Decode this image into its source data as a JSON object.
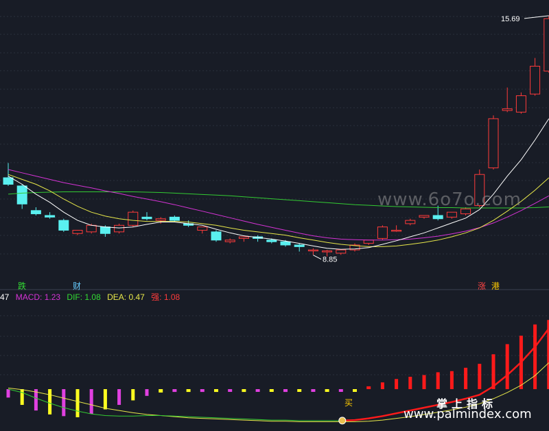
{
  "chart_data": [
    {
      "type": "candlestick",
      "title": "",
      "ylim": [
        7.8,
        16.0
      ],
      "annotations": {
        "high_label": "15.69",
        "low_label": "8.85"
      },
      "signals": [
        {
          "text": "跌",
          "color": "#33dd33"
        },
        {
          "text": "财",
          "color": "#66ccff"
        },
        {
          "text": "涨",
          "color": "#ff4444"
        },
        {
          "text": "港",
          "color": "#ffcc00"
        }
      ],
      "candles": [
        {
          "o": 10.75,
          "h": 11.2,
          "l": 10.5,
          "c": 10.55
        },
        {
          "o": 10.5,
          "h": 10.55,
          "l": 9.8,
          "c": 9.95
        },
        {
          "o": 9.75,
          "h": 9.85,
          "l": 9.6,
          "c": 9.65
        },
        {
          "o": 9.6,
          "h": 9.7,
          "l": 9.5,
          "c": 9.55
        },
        {
          "o": 9.45,
          "h": 9.5,
          "l": 9.1,
          "c": 9.15
        },
        {
          "o": 9.05,
          "h": 9.15,
          "l": 9.0,
          "c": 9.15
        },
        {
          "o": 9.1,
          "h": 9.35,
          "l": 9.05,
          "c": 9.3
        },
        {
          "o": 9.25,
          "h": 9.3,
          "l": 8.95,
          "c": 9.05
        },
        {
          "o": 9.1,
          "h": 9.35,
          "l": 9.05,
          "c": 9.3
        },
        {
          "o": 9.3,
          "h": 9.75,
          "l": 9.25,
          "c": 9.7
        },
        {
          "o": 9.55,
          "h": 9.7,
          "l": 9.45,
          "c": 9.5
        },
        {
          "o": 9.45,
          "h": 9.55,
          "l": 9.35,
          "c": 9.5
        },
        {
          "o": 9.55,
          "h": 9.6,
          "l": 9.4,
          "c": 9.45
        },
        {
          "o": 9.35,
          "h": 9.45,
          "l": 9.25,
          "c": 9.3
        },
        {
          "o": 9.15,
          "h": 9.25,
          "l": 9.05,
          "c": 9.25
        },
        {
          "o": 9.1,
          "h": 9.15,
          "l": 8.8,
          "c": 8.85
        },
        {
          "o": 8.8,
          "h": 8.9,
          "l": 8.75,
          "c": 8.85
        },
        {
          "o": 8.9,
          "h": 8.95,
          "l": 8.8,
          "c": 8.95
        },
        {
          "o": 8.95,
          "h": 9.0,
          "l": 8.8,
          "c": 8.9
        },
        {
          "o": 8.85,
          "h": 8.9,
          "l": 8.75,
          "c": 8.8
        },
        {
          "o": 8.8,
          "h": 8.85,
          "l": 8.65,
          "c": 8.7
        },
        {
          "o": 8.7,
          "h": 8.75,
          "l": 8.5,
          "c": 8.65
        },
        {
          "o": 8.55,
          "h": 8.6,
          "l": 8.4,
          "c": 8.55
        },
        {
          "o": 8.5,
          "h": 8.55,
          "l": 8.35,
          "c": 8.52
        },
        {
          "o": 8.45,
          "h": 8.55,
          "l": 8.4,
          "c": 8.55
        },
        {
          "o": 8.55,
          "h": 8.75,
          "l": 8.5,
          "c": 8.7
        },
        {
          "o": 8.75,
          "h": 8.85,
          "l": 8.7,
          "c": 8.85
        },
        {
          "o": 8.9,
          "h": 9.3,
          "l": 8.85,
          "c": 9.25
        },
        {
          "o": 9.15,
          "h": 9.3,
          "l": 9.1,
          "c": 9.15
        },
        {
          "o": 9.35,
          "h": 9.5,
          "l": 9.3,
          "c": 9.45
        },
        {
          "o": 9.55,
          "h": 9.6,
          "l": 9.5,
          "c": 9.6
        },
        {
          "o": 9.6,
          "h": 9.9,
          "l": 9.45,
          "c": 9.5
        },
        {
          "o": 9.55,
          "h": 9.7,
          "l": 9.5,
          "c": 9.7
        },
        {
          "o": 9.65,
          "h": 9.85,
          "l": 9.6,
          "c": 9.8
        },
        {
          "o": 9.9,
          "h": 11.0,
          "l": 9.85,
          "c": 10.85
        },
        {
          "o": 11.05,
          "h": 12.65,
          "l": 11.0,
          "c": 12.55
        },
        {
          "o": 12.8,
          "h": 13.5,
          "l": 12.75,
          "c": 12.85
        },
        {
          "o": 12.75,
          "h": 13.35,
          "l": 12.7,
          "c": 13.25
        },
        {
          "o": 13.3,
          "h": 14.4,
          "l": 13.25,
          "c": 14.15
        },
        {
          "o": 14.0,
          "h": 15.69,
          "l": 13.95,
          "c": 15.6
        }
      ],
      "ma_white": [
        10.8,
        10.55,
        10.25,
        10.0,
        9.7,
        9.45,
        9.3,
        9.25,
        9.22,
        9.25,
        9.33,
        9.4,
        9.4,
        9.35,
        9.3,
        9.18,
        9.07,
        8.98,
        8.93,
        8.88,
        8.82,
        8.75,
        8.67,
        8.6,
        8.57,
        8.58,
        8.62,
        8.72,
        8.83,
        8.95,
        9.07,
        9.22,
        9.37,
        9.52,
        9.78,
        10.25,
        10.8,
        11.3,
        11.9,
        12.55
      ],
      "ma_yellow": [
        10.85,
        10.7,
        10.55,
        10.35,
        10.1,
        9.88,
        9.7,
        9.58,
        9.5,
        9.45,
        9.42,
        9.42,
        9.42,
        9.4,
        9.35,
        9.3,
        9.22,
        9.15,
        9.1,
        9.05,
        9.0,
        8.92,
        8.85,
        8.78,
        8.72,
        8.68,
        8.65,
        8.65,
        8.67,
        8.72,
        8.78,
        8.85,
        8.95,
        9.07,
        9.22,
        9.45,
        9.73,
        10.03,
        10.37,
        10.75
      ],
      "ma_magenta": [
        11.0,
        10.9,
        10.8,
        10.7,
        10.6,
        10.52,
        10.44,
        10.35,
        10.27,
        10.18,
        10.1,
        10.02,
        9.93,
        9.83,
        9.73,
        9.63,
        9.53,
        9.43,
        9.33,
        9.24,
        9.15,
        9.06,
        8.98,
        8.92,
        8.88,
        8.86,
        8.85,
        8.85,
        8.86,
        8.88,
        8.92,
        8.97,
        9.04,
        9.12,
        9.23,
        9.37,
        9.55,
        9.75,
        9.97,
        10.2
      ],
      "ma_green": [
        10.25,
        10.28,
        10.3,
        10.31,
        10.32,
        10.32,
        10.32,
        10.32,
        10.32,
        10.32,
        10.31,
        10.3,
        10.28,
        10.26,
        10.24,
        10.22,
        10.2,
        10.17,
        10.14,
        10.11,
        10.08,
        10.05,
        10.02,
        9.99,
        9.96,
        9.93,
        9.91,
        9.89,
        9.87,
        9.86,
        9.85,
        9.84,
        9.84,
        9.83,
        9.83,
        9.83,
        9.83,
        9.83,
        9.84,
        9.86
      ]
    },
    {
      "type": "histogram",
      "title": "",
      "legend": {
        "prev_value": "47",
        "macd_label": "MACD: 1.23",
        "dif_label": "DIF: 1.08",
        "dea_label": "DEA: 0.47",
        "strong_label": "强: 1.08"
      },
      "buy_label": "买",
      "ylim": [
        -0.6,
        1.55
      ],
      "bars": [
        -0.15,
        -0.28,
        -0.38,
        -0.45,
        -0.48,
        -0.5,
        -0.44,
        -0.36,
        -0.28,
        -0.2,
        -0.12,
        -0.06,
        -0.05,
        -0.05,
        -0.05,
        -0.05,
        -0.04,
        -0.05,
        -0.04,
        -0.04,
        -0.05,
        -0.04,
        -0.04,
        -0.04,
        -0.04,
        -0.03,
        0.05,
        0.12,
        0.18,
        0.22,
        0.25,
        0.3,
        0.32,
        0.38,
        0.45,
        0.62,
        0.8,
        0.95,
        1.15,
        1.23
      ],
      "dif_line": [
        0.0,
        -0.06,
        -0.16,
        -0.25,
        -0.33,
        -0.39,
        -0.44,
        -0.47,
        -0.48,
        -0.48,
        -0.47,
        -0.47,
        -0.48,
        -0.49,
        -0.5,
        -0.51,
        -0.52,
        -0.53,
        -0.54,
        -0.55,
        -0.55,
        -0.56,
        -0.56,
        -0.56,
        -0.56,
        -0.55,
        -0.52,
        -0.48,
        -0.43,
        -0.38,
        -0.33,
        -0.28,
        -0.23,
        -0.17,
        -0.1,
        0.05,
        0.25,
        0.48,
        0.75,
        1.08
      ],
      "dea_line": [
        0.02,
        -0.01,
        -0.05,
        -0.1,
        -0.16,
        -0.22,
        -0.28,
        -0.34,
        -0.38,
        -0.42,
        -0.45,
        -0.47,
        -0.49,
        -0.51,
        -0.52,
        -0.53,
        -0.54,
        -0.55,
        -0.56,
        -0.57,
        -0.57,
        -0.58,
        -0.58,
        -0.58,
        -0.58,
        -0.58,
        -0.57,
        -0.55,
        -0.52,
        -0.49,
        -0.45,
        -0.41,
        -0.37,
        -0.32,
        -0.26,
        -0.17,
        -0.06,
        0.07,
        0.24,
        0.47
      ]
    }
  ],
  "watermark": {
    "top": "www.6o7o.com",
    "bottom": "www.palmindex.com",
    "bottom_cn": "掌上指标"
  },
  "colors": {
    "background": "#181c26",
    "up": "#ff3b3b",
    "down": "#5af0f0",
    "ma_white": "#ffffff",
    "ma_yellow": "#e8e84a",
    "ma_magenta": "#d633d6",
    "ma_green": "#33cc33",
    "bar_red": "#ff1a1a",
    "bar_magenta": "#e040e0",
    "bar_yellow": "#ffff20"
  }
}
